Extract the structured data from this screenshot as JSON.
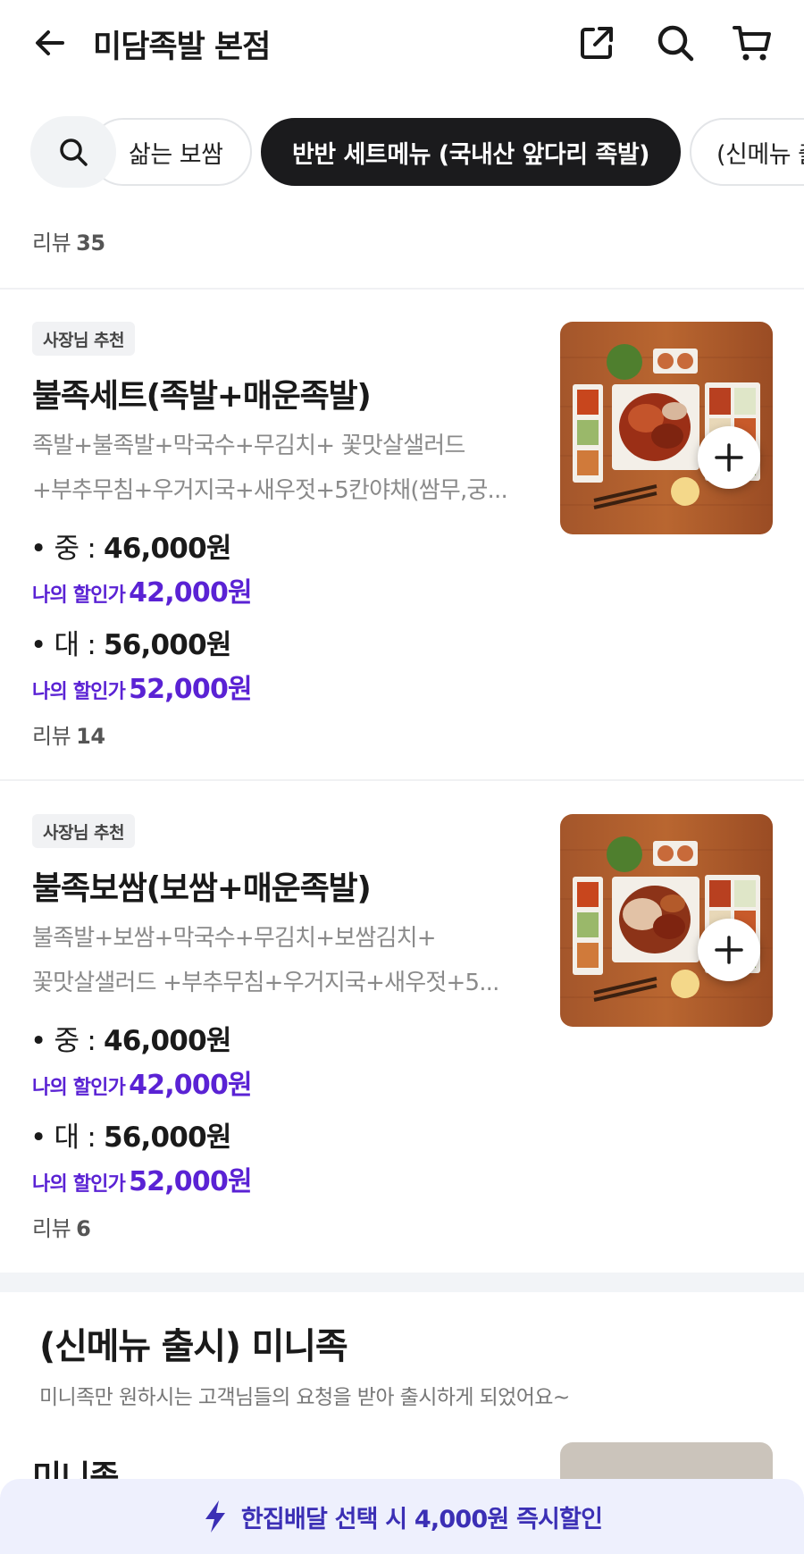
{
  "header": {
    "title": "미담족발 본점",
    "icons": [
      "back-arrow-icon",
      "share-icon",
      "search-icon",
      "cart-icon"
    ]
  },
  "chips": {
    "items": [
      "삶는 보쌈",
      "반반 세트메뉴 (국내산 앞다리 족발)",
      "(신메뉴 출시) 미니족"
    ],
    "selected_index": 1
  },
  "top_review": {
    "label": "리뷰",
    "count": "35"
  },
  "menu_items": [
    {
      "badge": "사장님 추천",
      "name": "불족세트(족발+매운족발)",
      "desc_line1": "족발+불족발+막국수+무김치+ 꽃맛살샐러드",
      "desc_line2": "+부추무침+우거지국+새우젓+5칸야채(쌈무,궁...",
      "price1_label": "• 중 : ",
      "price1": "46,000원",
      "disc_label": "나의 할인가",
      "disc1": "42,000원",
      "price2_label": "• 대 : ",
      "price2": "56,000원",
      "disc2": "52,000원",
      "review_label": "리뷰",
      "review_count": "14"
    },
    {
      "badge": "사장님 추천",
      "name": "불족보쌈(보쌈+매운족발)",
      "desc_line1": "불족발+보쌈+막국수+무김치+보쌈김치+",
      "desc_line2": "꽃맛살샐러드 +부추무침+우거지국+새우젓+5...",
      "price1_label": "• 중 : ",
      "price1": "46,000원",
      "disc_label": "나의 할인가",
      "disc1": "42,000원",
      "price2_label": "• 대 : ",
      "price2": "56,000원",
      "disc2": "52,000원",
      "review_label": "리뷰",
      "review_count": "6"
    }
  ],
  "section": {
    "title": "(신메뉴 출시) 미니족",
    "desc": "미니족만 원하시는 고객님들의 요청을 받아 출시하게 되었어요~",
    "next_item_name": "미니족"
  },
  "banner": {
    "icon": "lightning-icon",
    "text": "한집배달 선택 시 4,000원 즉시할인"
  },
  "colors": {
    "accent_purple": "#5a22d4",
    "chip_selected_bg": "#1b1b1d",
    "banner_bg": "#eef0fd",
    "banner_text": "#3b2fb5"
  }
}
